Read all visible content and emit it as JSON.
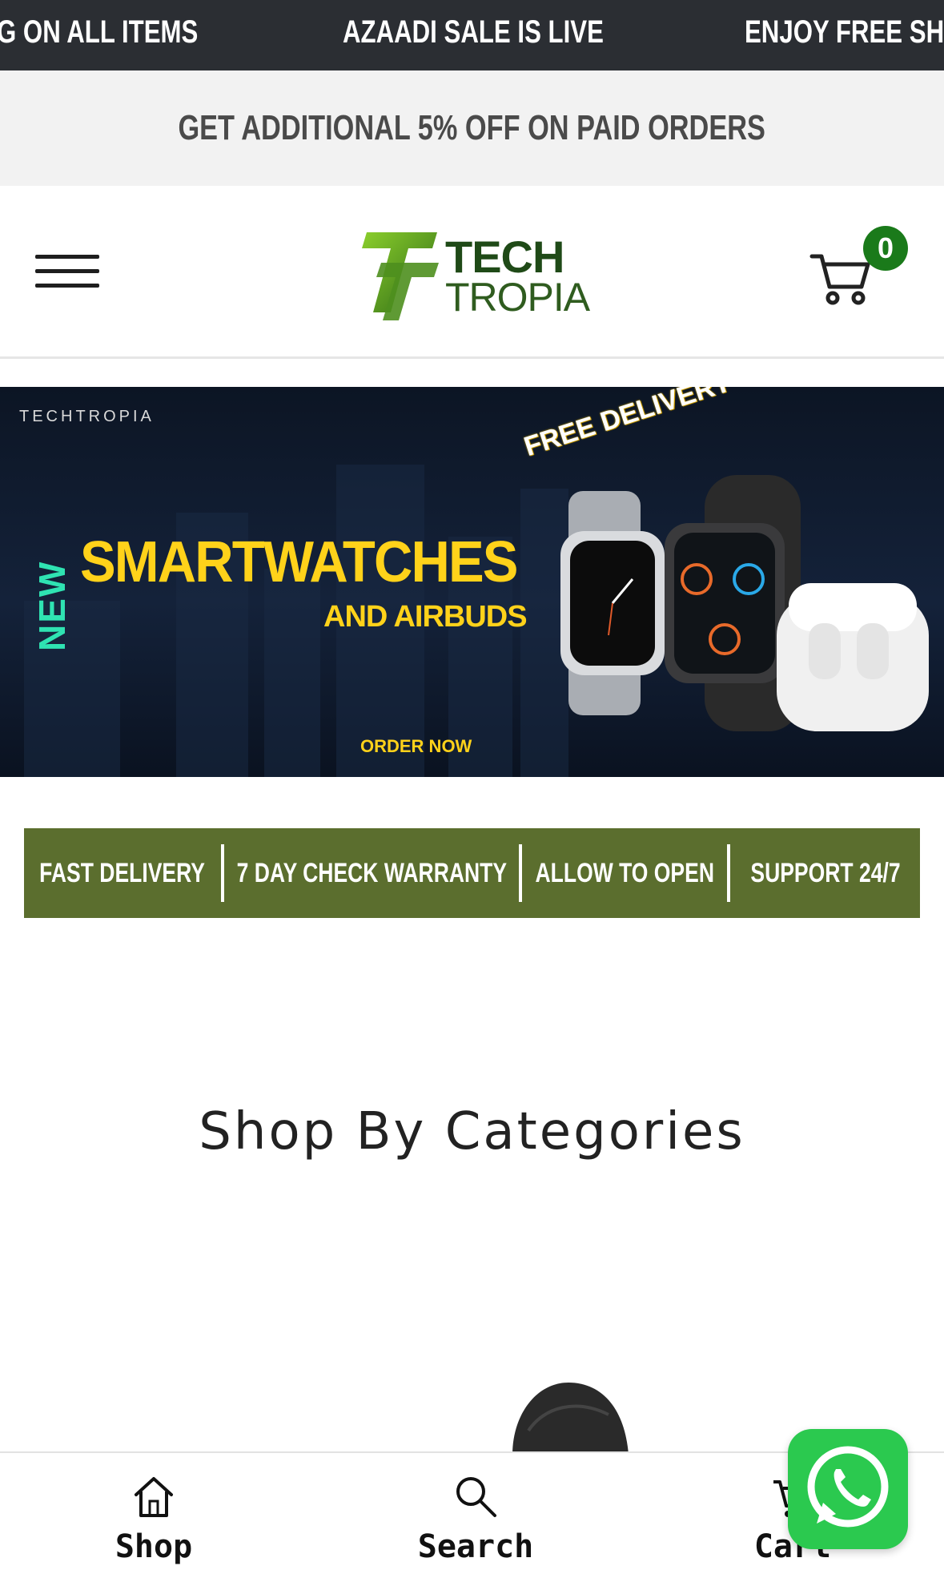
{
  "marquee": {
    "items": [
      "G ON ALL ITEMS",
      "AZAADI SALE IS LIVE",
      "ENJOY FREE SHIP"
    ]
  },
  "promo": {
    "text": "GET ADDITIONAL 5% OFF ON PAID ORDERS"
  },
  "header": {
    "logo_line1": "TECH",
    "logo_line2": "TROPIA",
    "cart_count": "0"
  },
  "banner": {
    "brand": "TECHTROPIA",
    "new_label": "NEW",
    "headline": "SMARTWATCHES",
    "subheadline": "AND AIRBUDS",
    "badge": "FREE DELIVERY",
    "cta": "ORDER NOW"
  },
  "features": [
    "FAST DELIVERY",
    "7 DAY CHECK WARRANTY",
    "ALLOW TO OPEN",
    "SUPPORT 24/7"
  ],
  "sections": {
    "categories_title": "Shop By Categories"
  },
  "bottom_nav": {
    "items": [
      {
        "label": "Shop",
        "icon": "home-icon"
      },
      {
        "label": "Search",
        "icon": "search-icon"
      },
      {
        "label": "Cart",
        "icon": "cart-icon"
      }
    ]
  },
  "colors": {
    "marquee_bg": "#2b2e33",
    "feature_bg": "#5b6e2e",
    "banner_accent": "#ffd21a",
    "badge_green": "#1a7a1a",
    "whatsapp": "#2bc94f"
  }
}
